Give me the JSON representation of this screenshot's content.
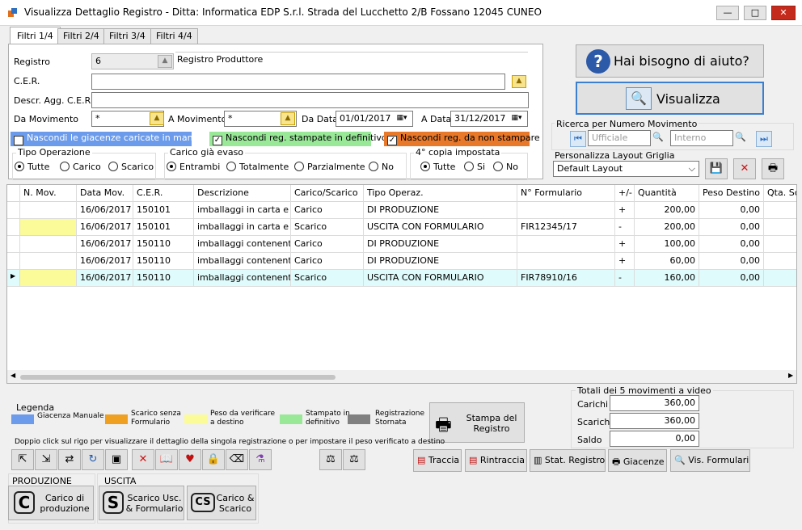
{
  "window": {
    "title": "Visualizza Dettaglio Registro - Ditta: Informatica EDP S.r.l. Strada del Lucchetto 2/B Fossano 12045 CUNEO",
    "minimize": "—",
    "maximize": "□",
    "close": "✕"
  },
  "tabs": [
    "Filtri 1/4",
    "Filtri 2/4",
    "Filtri 3/4",
    "Filtri 4/4"
  ],
  "filters": {
    "registro_label": "Registro",
    "registro_value": "6",
    "registro_desc": "Registro Produttore",
    "cer_label": "C.E.R.",
    "cer_value": "",
    "descr_label": "Descr. Agg. C.E.R.",
    "descr_value": "",
    "da_mov_label": "Da Movimento",
    "da_mov_value": "*",
    "a_mov_label": "A Movimento",
    "a_mov_value": "*",
    "da_data_label": "Da Data",
    "da_data_value": "01/01/2017",
    "a_data_label": "A Data",
    "a_data_value": "31/12/2017",
    "chk_giacenze": "Nascondi le giacenze caricate in manuale",
    "chk_stampate": "Nascondi reg. stampate in definitivo",
    "chk_nonstampare": "Nascondi reg. da non stampare",
    "tipo_op_title": "Tipo Operazione",
    "tipo_op_options": [
      "Tutte",
      "Carico",
      "Scarico"
    ],
    "carico_title": "Carico già evaso",
    "carico_options": [
      "Entrambi",
      "Totalmente",
      "Parzialmente",
      "No"
    ],
    "copia_title": "4° copia impostata",
    "copia_options": [
      "Tutte",
      "Si",
      "No"
    ]
  },
  "right": {
    "help_label": "Hai bisogno di aiuto?",
    "help_icon": "?",
    "visualizza_label": "Visualizza",
    "ricerca_title": "Ricerca per Numero Movimento",
    "ufficiale_placeholder": "Ufficiale",
    "interno_placeholder": "Interno",
    "layout_title": "Personalizza Layout Griglia",
    "layout_value": "Default Layout"
  },
  "grid": {
    "columns": [
      "N. Mov.",
      "Data Mov.",
      "C.E.R.",
      "Descrizione",
      "Carico/Scarico",
      "Tipo Operaz.",
      "N° Formulario",
      "+/-",
      "Quantità",
      "Peso Destino",
      "Qta. Sc"
    ],
    "rows": [
      {
        "nmov": "",
        "data": "16/06/2017",
        "cer": "150101",
        "descr": "imballaggi in carta e ...",
        "cs": "Carico",
        "tipo": "DI PRODUZIONE",
        "form": "",
        "seg": "+",
        "qta": "200,00",
        "peso": "0,00"
      },
      {
        "nmov": "",
        "data": "16/06/2017",
        "cer": "150101",
        "descr": "imballaggi in carta e ...",
        "cs": "Scarico",
        "tipo": "USCITA CON FORMULARIO",
        "form": "FIR12345/17",
        "seg": "-",
        "qta": "200,00",
        "peso": "0,00"
      },
      {
        "nmov": "",
        "data": "16/06/2017",
        "cer": "150110",
        "descr": "imballaggi contenenti...",
        "cs": "Carico",
        "tipo": "DI PRODUZIONE",
        "form": "",
        "seg": "+",
        "qta": "100,00",
        "peso": "0,00"
      },
      {
        "nmov": "",
        "data": "16/06/2017",
        "cer": "150110",
        "descr": "imballaggi contenenti...",
        "cs": "Carico",
        "tipo": "DI PRODUZIONE",
        "form": "",
        "seg": "+",
        "qta": "60,00",
        "peso": "0,00"
      },
      {
        "nmov": "",
        "data": "16/06/2017",
        "cer": "150110",
        "descr": "imballaggi contenenti...",
        "cs": "Scarico",
        "tipo": "USCITA CON FORMULARIO",
        "form": "FIR78910/16",
        "seg": "-",
        "qta": "160,00",
        "peso": "0,00"
      }
    ]
  },
  "legend": {
    "title": "Legenda",
    "items": [
      {
        "label": "Giacenza Manuale",
        "color": "#6b9bea"
      },
      {
        "label": "Scarico senza Formulario",
        "color": "#f0a020"
      },
      {
        "label": "Peso da verificare a destino",
        "color": "#fbfb9a"
      },
      {
        "label": "Stampato in definitivo",
        "color": "#98e898"
      },
      {
        "label": "Registrazione Stornata",
        "color": "#808080"
      }
    ]
  },
  "colors": {
    "yellow_cell": "#fbfb9a",
    "selected_row": "#e0fbfb",
    "chk_blue": "#6b9bea",
    "chk_green": "#98e898",
    "chk_orange": "#e8782a"
  },
  "stampa_registro": "Stampa del Registro",
  "totals": {
    "title": "Totali dei 5 movimenti a video",
    "carichi_label": "Carichi",
    "carichi_value": "360,00",
    "scarichi_label": "Scarichi",
    "scarichi_value": "360,00",
    "saldo_label": "Saldo",
    "saldo_value": "0,00"
  },
  "hint": "Doppio click sul rigo per visualizzare il dettaglio della singola registrazione o per impostare il peso verificato a destino",
  "toolbar": {
    "traccia": "Traccia",
    "rintraccia": "Rintraccia",
    "stat_registro": "Stat. Registro",
    "giacenze": "Giacenze",
    "vis_formulari": "Vis. Formulari"
  },
  "produzione": {
    "title": "PRODUZIONE",
    "carico_label": "Carico di produzione"
  },
  "uscita": {
    "title": "USCITA",
    "scarico_label": "Scarico Usc. & Formulario",
    "carico_scarico_label": "Carico & Scarico"
  }
}
